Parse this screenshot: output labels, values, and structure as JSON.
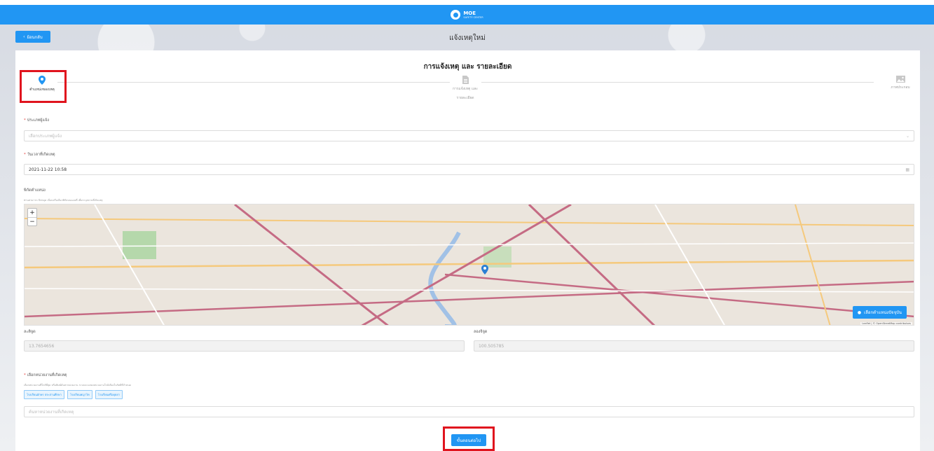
{
  "brand": {
    "name": "MOE",
    "tagline": "SAFETY CENTER"
  },
  "header": {
    "back_label": "ย้อนกลับ",
    "title": "แจ้งเหตุใหม่"
  },
  "form": {
    "title": "การแจ้งเหตุ และ รายละเอียด",
    "steps": [
      {
        "label": "ตำแหน่งของเหตุ",
        "icon": "location-pin-icon",
        "active": true
      },
      {
        "label_line1": "การแจ้งเหตุ และ",
        "label_line2": "รายละเอียด",
        "icon": "document-icon",
        "active": false
      },
      {
        "label": "ภาพประกอบ",
        "icon": "image-icon",
        "active": false
      }
    ],
    "victim_type": {
      "label": "ประเภทผู้แจ้ง",
      "placeholder": "เลือกประเภทผู้แจ้ง"
    },
    "datetime": {
      "label": "วันเวลาที่เกิดเหตุ",
      "value": "2021-11-22 10:58"
    },
    "location": {
      "label": "พิกัดตำแหน่ง",
      "hint": "ท่านสามารถ ปักหมุด เลื่อนหรือเลือกพิกัดบนแผนที่ เพื่อระบุสถานที่เกิดเหตุ"
    },
    "map": {
      "zoom_in": "+",
      "zoom_out": "−",
      "current_location_label": "เลือกตำแหน่งปัจจุบัน",
      "attribution": "Leaflet | © OpenStreetMap contributors"
    },
    "latitude": {
      "label": "ละติจูด",
      "value": "13.7654656"
    },
    "longitude": {
      "label": "ลองจิจูด",
      "value": "100.505785"
    },
    "unit": {
      "label": "เลือกหน่วยงานที่เกิดเหตุ",
      "hint": "เลือกหน่วยงานที่ใกล้ที่สุด หรือพิมพ์ค้นหาหน่วยงาน ระบบจะแสดงหน่วยงานใกล้เคียงในรัศมีที่กำหนด",
      "tags": [
        "โรงเรียนอักษร ประสานศึกษา",
        "โรงเรียนพญาไท",
        "โรงเรียนศรีอยุธยา"
      ],
      "search_placeholder": "ค้นหาหน่วยงานที่เกิดเหตุ"
    },
    "next_label": "ขั้นตอนต่อไป"
  },
  "colors": {
    "primary": "#2196f3",
    "highlight": "#e0141e"
  }
}
